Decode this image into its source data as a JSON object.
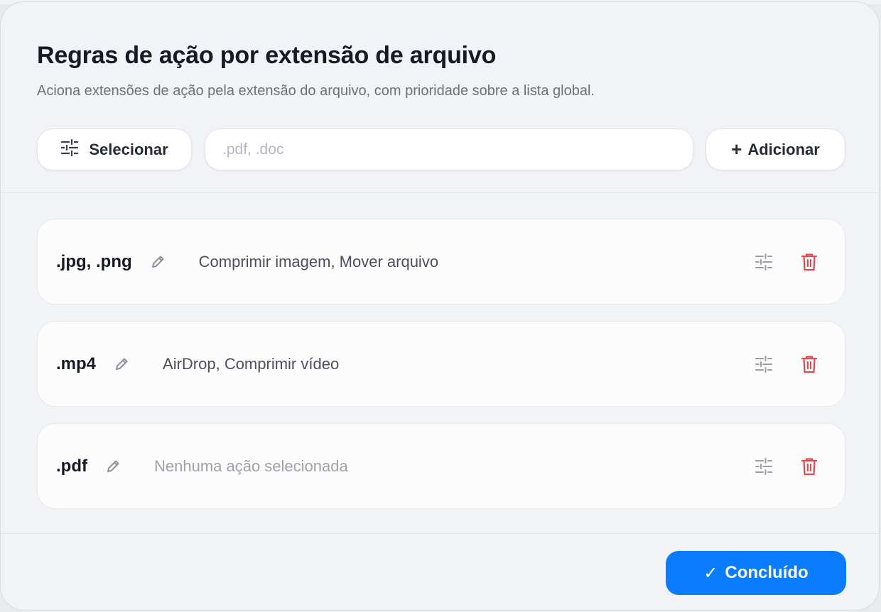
{
  "modal": {
    "title": "Regras de ação por extensão de arquivo",
    "subtitle": "Aciona extensões de ação pela extensão do arquivo, com prioridade sobre a lista global."
  },
  "toolbar": {
    "select_label": "Selecionar",
    "select_icon": "sliders-icon",
    "input_value": "",
    "input_placeholder": ".pdf, .doc",
    "add_symbol": "+",
    "add_label": "Adicionar"
  },
  "rules": [
    {
      "extension": ".jpg, .png",
      "actions": "Comprimir imagem, Mover arquivo",
      "has_actions": true
    },
    {
      "extension": ".mp4",
      "actions": "AirDrop, Comprimir vídeo",
      "has_actions": true
    },
    {
      "extension": ".pdf",
      "actions": "Nenhuma ação selecionada",
      "has_actions": false
    }
  ],
  "row_icons": {
    "edit": "pencil-icon",
    "configure": "sliders-icon",
    "delete": "trash-icon"
  },
  "footer": {
    "done_symbol": "✓",
    "done_label": "Concluído"
  },
  "colors": {
    "accent": "#0a7cff",
    "danger": "#e5484d",
    "muted_icon": "#9a9ea6",
    "background": "#f2f3f6"
  }
}
